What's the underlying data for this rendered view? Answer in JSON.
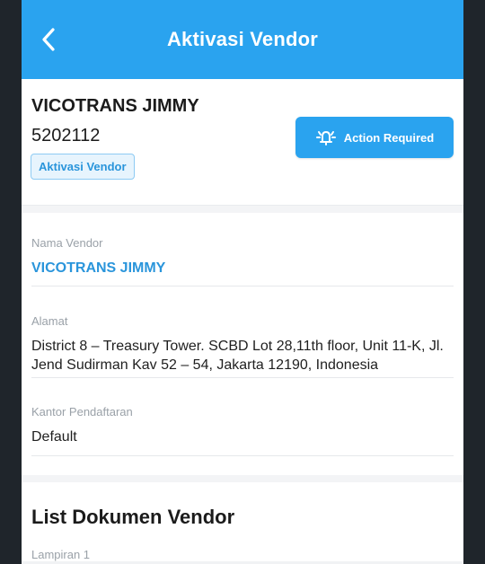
{
  "appbar": {
    "title": "Aktivasi Vendor"
  },
  "vendor": {
    "name": "VICOTRANS JIMMY",
    "code": "5202112",
    "status_chip": "Aktivasi Vendor"
  },
  "action_button": {
    "label": "Action Required"
  },
  "fields": [
    {
      "label": "Nama Vendor",
      "value": "VICOTRANS JIMMY"
    },
    {
      "label": "Alamat",
      "value": "District 8 – Treasury Tower. SCBD Lot 28,11th floor, Unit 11-K, Jl. Jend Sudirman Kav 52 – 54, Jakarta 12190, Indonesia"
    },
    {
      "label": "Kantor Pendaftaran",
      "value": "Default"
    }
  ],
  "documents": {
    "title": "List Dokumen Vendor",
    "first_label": "Lampiran 1"
  },
  "colors": {
    "accent": "#2aa3ef",
    "link": "#2a95db",
    "label": "#9aa1a8"
  },
  "icons": {
    "back": "chevron-left-icon",
    "action": "bell-alert-icon"
  }
}
